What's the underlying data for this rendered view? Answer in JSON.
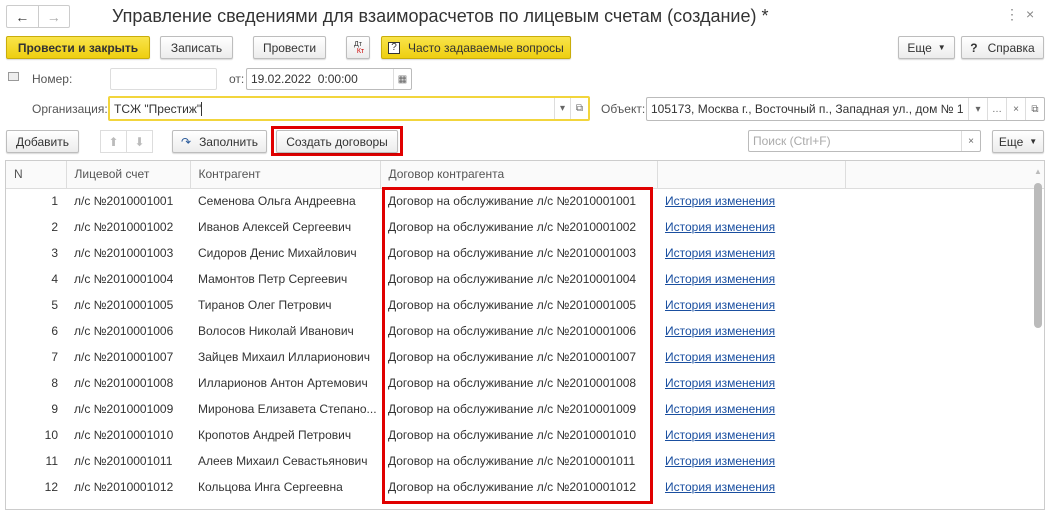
{
  "window": {
    "title": "Управление сведениями для взаиморасчетов по лицевым счетам (создание) *"
  },
  "toolbar": {
    "post_close": "Провести и закрыть",
    "save": "Записать",
    "post": "Провести",
    "dtkt_top": "Дт",
    "dtkt_bottom": "Кт",
    "faq": "Часто задаваемые вопросы",
    "more": "Еще",
    "help": "Справка"
  },
  "form": {
    "number_label": "Номер:",
    "number_value": "",
    "date_label": "от:",
    "date_value": "19.02.2022  0:00:00",
    "org_label": "Организация:",
    "org_value": "ТСЖ \"Престиж\"",
    "object_label": "Объект:",
    "object_value": "105173, Москва г., Восточный п., Западная ул., дом № 1"
  },
  "table_toolbar": {
    "add": "Добавить",
    "fill": "Заполнить",
    "create_contracts": "Создать договоры",
    "search_placeholder": "Поиск (Ctrl+F)",
    "more": "Еще"
  },
  "table": {
    "headers": [
      "N",
      "Лицевой счет",
      "Контрагент",
      "Договор контрагента",
      ""
    ],
    "rows": [
      [
        "1",
        "л/с №2010001001",
        "Семенова Ольга Андреевна",
        "Договор на обслуживание л/с №2010001001",
        "История изменения"
      ],
      [
        "2",
        "л/с №2010001002",
        "Иванов Алексей Сергеевич",
        "Договор на обслуживание л/с №2010001002",
        "История изменения"
      ],
      [
        "3",
        "л/с №2010001003",
        "Сидоров Денис Михайлович",
        "Договор на обслуживание л/с №2010001003",
        "История изменения"
      ],
      [
        "4",
        "л/с №2010001004",
        "Мамонтов Петр Сергеевич",
        "Договор на обслуживание л/с №2010001004",
        "История изменения"
      ],
      [
        "5",
        "л/с №2010001005",
        "Тиранов Олег Петрович",
        "Договор на обслуживание л/с №2010001005",
        "История изменения"
      ],
      [
        "6",
        "л/с №2010001006",
        "Волосов Николай Иванович",
        "Договор на обслуживание л/с №2010001006",
        "История изменения"
      ],
      [
        "7",
        "л/с №2010001007",
        "Зайцев Михаил Илларионович",
        "Договор на обслуживание л/с №2010001007",
        "История изменения"
      ],
      [
        "8",
        "л/с №2010001008",
        "Илларионов Антон Артемович",
        "Договор на обслуживание л/с №2010001008",
        "История изменения"
      ],
      [
        "9",
        "л/с №2010001009",
        "Миронова Елизавета Степано...",
        "Договор на обслуживание л/с №2010001009",
        "История изменения"
      ],
      [
        "10",
        "л/с №2010001010",
        "Кропотов Андрей Петрович",
        "Договор на обслуживание л/с №2010001010",
        "История изменения"
      ],
      [
        "11",
        "л/с №2010001011",
        "Алеев Михаил Севастьянович",
        "Договор на обслуживание л/с №2010001011",
        "История изменения"
      ],
      [
        "12",
        "л/с №2010001012",
        "Кольцова Инга Сергеевна",
        "Договор на обслуживание л/с №2010001012",
        "История изменения"
      ]
    ]
  }
}
